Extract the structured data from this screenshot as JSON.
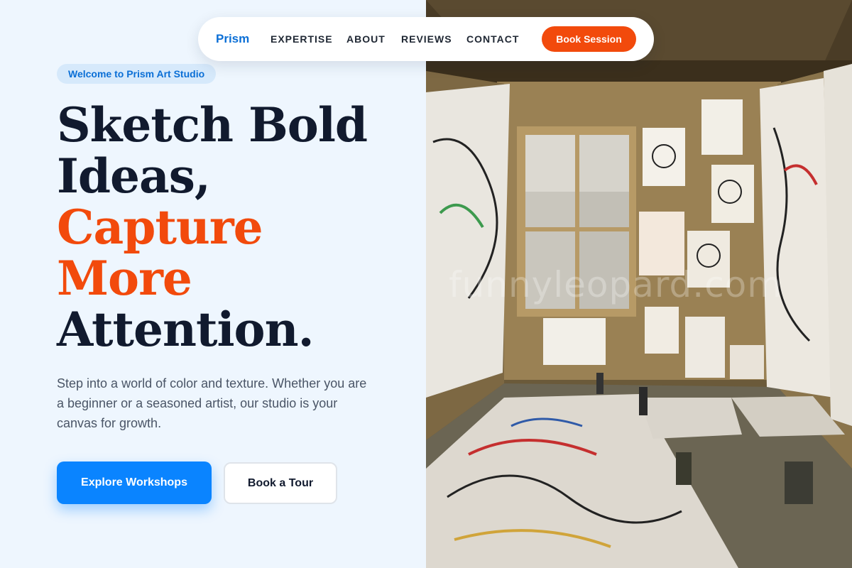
{
  "nav": {
    "logo": "Prism",
    "links": [
      "EXPERTISE",
      "ABOUT",
      "REVIEWS",
      "CONTACT"
    ],
    "cta": "Book Session"
  },
  "hero": {
    "badge": "Welcome to Prism Art Studio",
    "headline": {
      "line1": "Sketch Bold",
      "line2": "Ideas,",
      "line3": "Capture",
      "line4": "More",
      "line5": "Attention."
    },
    "description": "Step into a world of color and texture. Whether you are a beginner or a seasoned artist, our studio is your canvas for growth.",
    "primary_button": "Explore Workshops",
    "secondary_button": "Book a Tour",
    "image_watermark": "funnyleopard.com"
  },
  "colors": {
    "brand_blue": "#0a84ff",
    "accent_orange": "#f24a0c",
    "heading_dark": "#111a2e",
    "page_background": "#eef6fe"
  }
}
